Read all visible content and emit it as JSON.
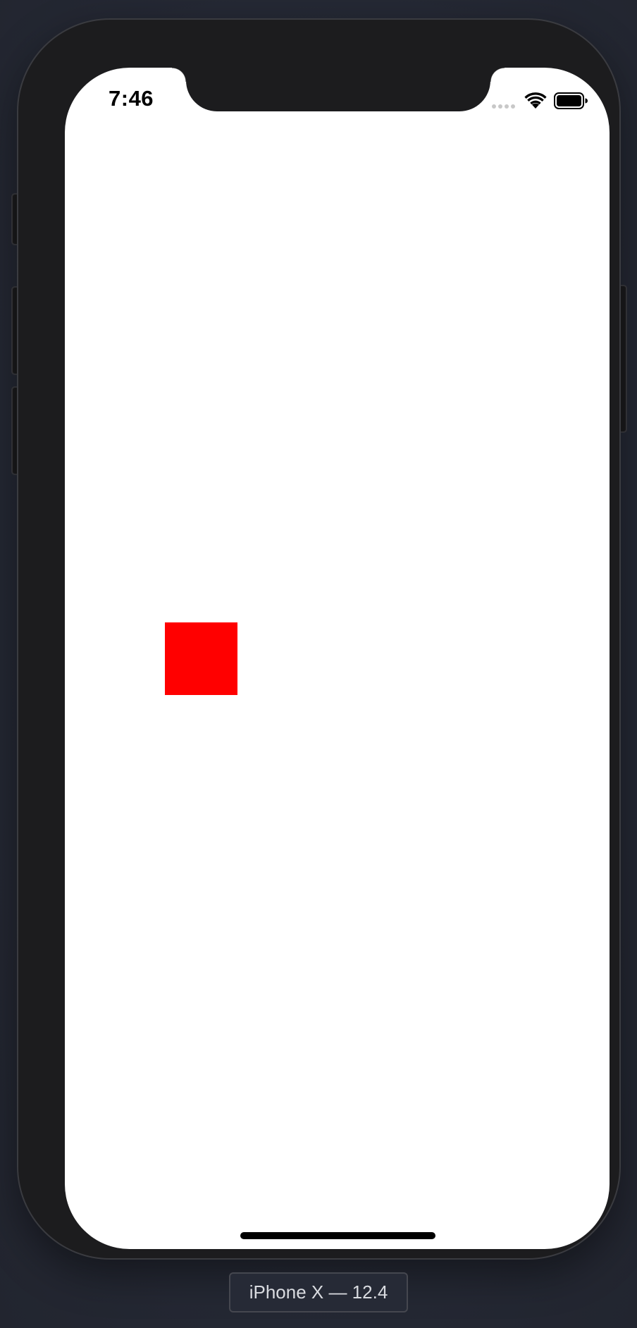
{
  "simulator": {
    "device_label": "iPhone X — 12.4"
  },
  "status_bar": {
    "time": "7:46",
    "icons": [
      "signal-dots-icon",
      "wifi-icon",
      "battery-icon"
    ]
  },
  "content": {
    "square_color": "#ff0000",
    "background_color": "#ffffff"
  }
}
